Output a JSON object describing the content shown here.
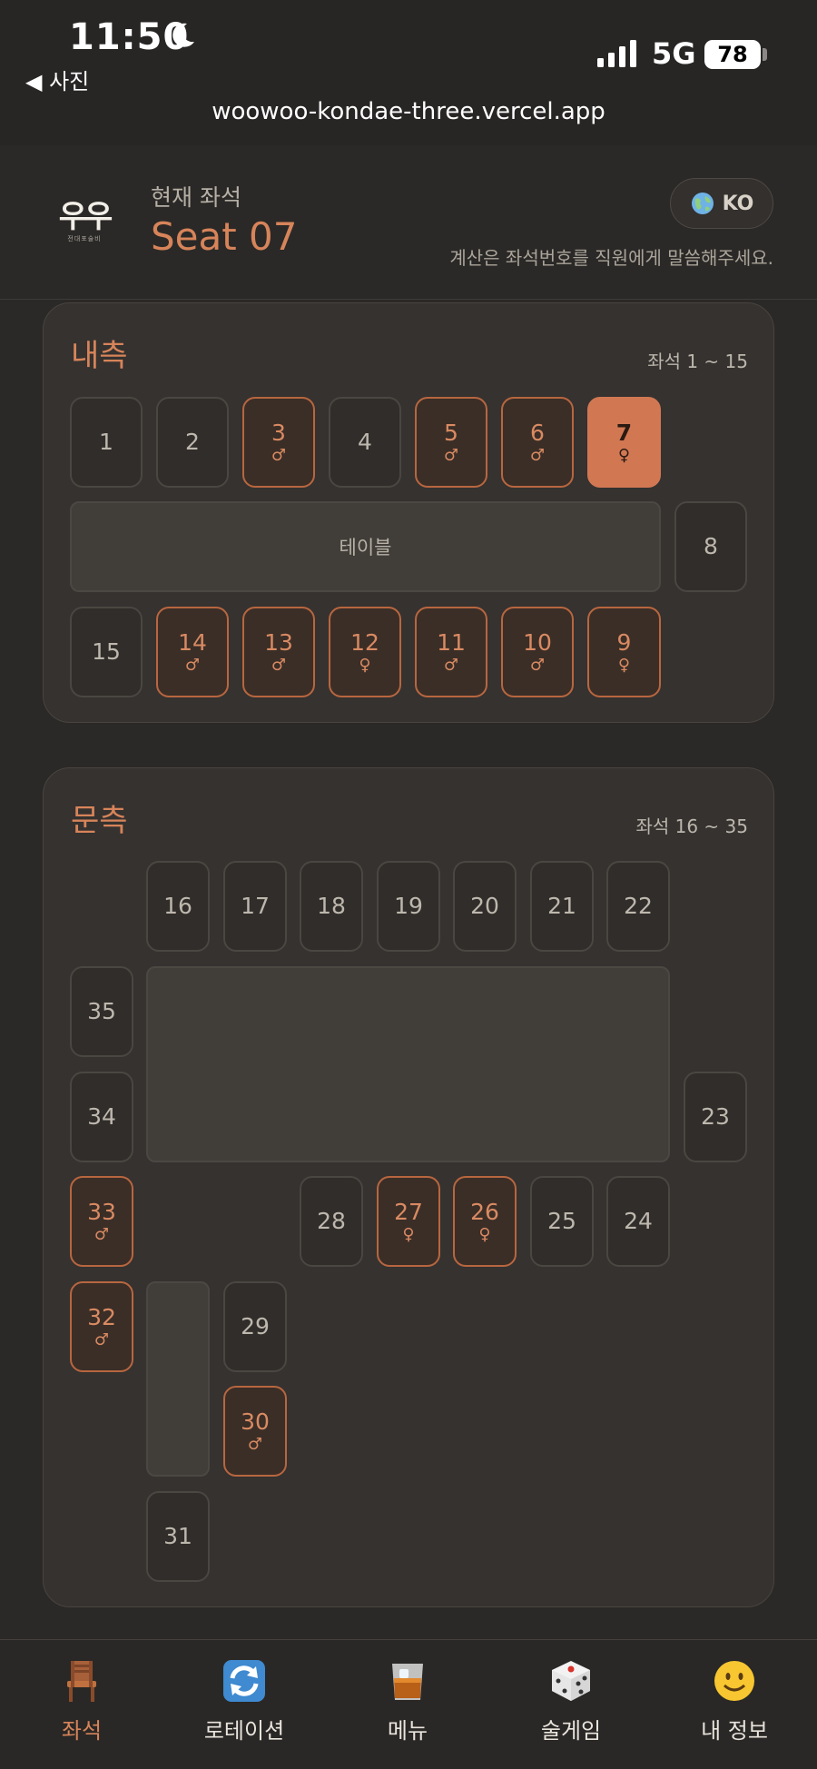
{
  "status": {
    "time": "11:50",
    "back_app": "◀ 사진",
    "network": "5G",
    "battery": "78",
    "url": "woowoo-kondae-three.vercel.app"
  },
  "header": {
    "logo": "우우",
    "logo_sub": "전대포술비",
    "current_label": "현재 좌석",
    "current_seat": "Seat 07",
    "lang": "KO",
    "notice": "계산은 좌석번호를 직원에게 말씀해주세요."
  },
  "inner": {
    "title": "내측",
    "range": "좌석 1 ~ 15",
    "table_label": "테이블",
    "seats": {
      "s1": {
        "num": "1",
        "gender": ""
      },
      "s2": {
        "num": "2",
        "gender": ""
      },
      "s3": {
        "num": "3",
        "gender": "♂"
      },
      "s4": {
        "num": "4",
        "gender": ""
      },
      "s5": {
        "num": "5",
        "gender": "♂"
      },
      "s6": {
        "num": "6",
        "gender": "♂"
      },
      "s7": {
        "num": "7",
        "gender": "♀"
      },
      "s8": {
        "num": "8",
        "gender": ""
      },
      "s9": {
        "num": "9",
        "gender": "♀"
      },
      "s10": {
        "num": "10",
        "gender": "♂"
      },
      "s11": {
        "num": "11",
        "gender": "♂"
      },
      "s12": {
        "num": "12",
        "gender": "♀"
      },
      "s13": {
        "num": "13",
        "gender": "♂"
      },
      "s14": {
        "num": "14",
        "gender": "♂"
      },
      "s15": {
        "num": "15",
        "gender": ""
      }
    }
  },
  "door": {
    "title": "문측",
    "range": "좌석 16 ~ 35",
    "seats": {
      "s16": {
        "num": "16",
        "gender": ""
      },
      "s17": {
        "num": "17",
        "gender": ""
      },
      "s18": {
        "num": "18",
        "gender": ""
      },
      "s19": {
        "num": "19",
        "gender": ""
      },
      "s20": {
        "num": "20",
        "gender": ""
      },
      "s21": {
        "num": "21",
        "gender": ""
      },
      "s22": {
        "num": "22",
        "gender": ""
      },
      "s23": {
        "num": "23",
        "gender": ""
      },
      "s24": {
        "num": "24",
        "gender": ""
      },
      "s25": {
        "num": "25",
        "gender": ""
      },
      "s26": {
        "num": "26",
        "gender": "♀"
      },
      "s27": {
        "num": "27",
        "gender": "♀"
      },
      "s28": {
        "num": "28",
        "gender": ""
      },
      "s29": {
        "num": "29",
        "gender": ""
      },
      "s30": {
        "num": "30",
        "gender": "♂"
      },
      "s31": {
        "num": "31",
        "gender": ""
      },
      "s32": {
        "num": "32",
        "gender": "♂"
      },
      "s33": {
        "num": "33",
        "gender": "♂"
      },
      "s34": {
        "num": "34",
        "gender": ""
      },
      "s35": {
        "num": "35",
        "gender": ""
      }
    }
  },
  "nav": {
    "seat": "좌석",
    "rotation": "로테이션",
    "menu": "메뉴",
    "drink_game": "술게임",
    "my_info": "내 정보"
  },
  "colors": {
    "accent": "#d7845a",
    "selected_seat": "#d17853",
    "background": "#2b2927",
    "panel": "#353230"
  },
  "icons": {
    "seat_tab": "chair-icon",
    "rotation_tab": "rotation-arrows-icon",
    "menu_tab": "whiskey-glass-icon",
    "game_tab": "dice-icon",
    "info_tab": "smiley-icon"
  }
}
